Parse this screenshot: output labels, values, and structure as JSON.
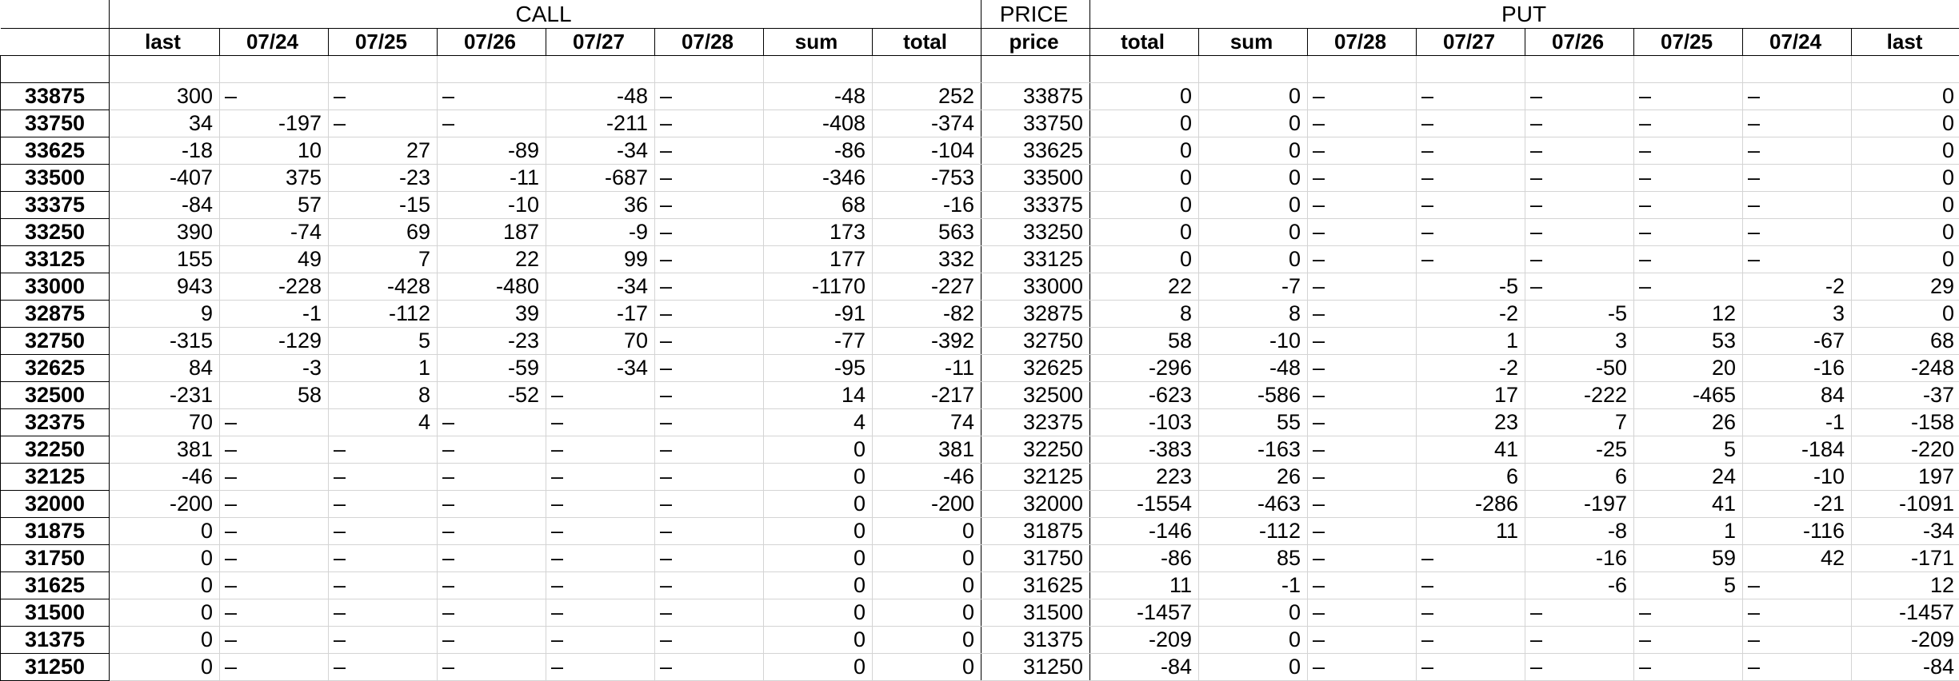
{
  "groups": {
    "call": "CALL",
    "price": "PRICE",
    "put": "PUT"
  },
  "columns": [
    "last",
    "07/24",
    "07/25",
    "07/26",
    "07/27",
    "07/28",
    "sum",
    "total",
    "price",
    "total",
    "sum",
    "07/28",
    "07/27",
    "07/26",
    "07/25",
    "07/24",
    "last"
  ],
  "rows": [
    {
      "label": "33875",
      "cells": [
        "300",
        "–",
        "–",
        "–",
        "-48",
        "–",
        "-48",
        "252",
        "33875",
        "0",
        "0",
        "–",
        "–",
        "–",
        "–",
        "–",
        "0"
      ]
    },
    {
      "label": "33750",
      "cells": [
        "34",
        "-197",
        "–",
        "–",
        "-211",
        "–",
        "-408",
        "-374",
        "33750",
        "0",
        "0",
        "–",
        "–",
        "–",
        "–",
        "–",
        "0"
      ]
    },
    {
      "label": "33625",
      "cells": [
        "-18",
        "10",
        "27",
        "-89",
        "-34",
        "–",
        "-86",
        "-104",
        "33625",
        "0",
        "0",
        "–",
        "–",
        "–",
        "–",
        "–",
        "0"
      ]
    },
    {
      "label": "33500",
      "cells": [
        "-407",
        "375",
        "-23",
        "-11",
        "-687",
        "–",
        "-346",
        "-753",
        "33500",
        "0",
        "0",
        "–",
        "–",
        "–",
        "–",
        "–",
        "0"
      ]
    },
    {
      "label": "33375",
      "cells": [
        "-84",
        "57",
        "-15",
        "-10",
        "36",
        "–",
        "68",
        "-16",
        "33375",
        "0",
        "0",
        "–",
        "–",
        "–",
        "–",
        "–",
        "0"
      ]
    },
    {
      "label": "33250",
      "cells": [
        "390",
        "-74",
        "69",
        "187",
        "-9",
        "–",
        "173",
        "563",
        "33250",
        "0",
        "0",
        "–",
        "–",
        "–",
        "–",
        "–",
        "0"
      ]
    },
    {
      "label": "33125",
      "cells": [
        "155",
        "49",
        "7",
        "22",
        "99",
        "–",
        "177",
        "332",
        "33125",
        "0",
        "0",
        "–",
        "–",
        "–",
        "–",
        "–",
        "0"
      ]
    },
    {
      "label": "33000",
      "cells": [
        "943",
        "-228",
        "-428",
        "-480",
        "-34",
        "–",
        "-1170",
        "-227",
        "33000",
        "22",
        "-7",
        "–",
        "-5",
        "–",
        "–",
        "-2",
        "29"
      ]
    },
    {
      "label": "32875",
      "cells": [
        "9",
        "-1",
        "-112",
        "39",
        "-17",
        "–",
        "-91",
        "-82",
        "32875",
        "8",
        "8",
        "–",
        "-2",
        "-5",
        "12",
        "3",
        "0"
      ]
    },
    {
      "label": "32750",
      "cells": [
        "-315",
        "-129",
        "5",
        "-23",
        "70",
        "–",
        "-77",
        "-392",
        "32750",
        "58",
        "-10",
        "–",
        "1",
        "3",
        "53",
        "-67",
        "68"
      ]
    },
    {
      "label": "32625",
      "cells": [
        "84",
        "-3",
        "1",
        "-59",
        "-34",
        "–",
        "-95",
        "-11",
        "32625",
        "-296",
        "-48",
        "–",
        "-2",
        "-50",
        "20",
        "-16",
        "-248"
      ]
    },
    {
      "label": "32500",
      "cells": [
        "-231",
        "58",
        "8",
        "-52",
        "–",
        "–",
        "14",
        "-217",
        "32500",
        "-623",
        "-586",
        "–",
        "17",
        "-222",
        "-465",
        "84",
        "-37"
      ]
    },
    {
      "label": "32375",
      "cells": [
        "70",
        "–",
        "4",
        "–",
        "–",
        "–",
        "4",
        "74",
        "32375",
        "-103",
        "55",
        "–",
        "23",
        "7",
        "26",
        "-1",
        "-158"
      ]
    },
    {
      "label": "32250",
      "cells": [
        "381",
        "–",
        "–",
        "–",
        "–",
        "–",
        "0",
        "381",
        "32250",
        "-383",
        "-163",
        "–",
        "41",
        "-25",
        "5",
        "-184",
        "-220"
      ]
    },
    {
      "label": "32125",
      "cells": [
        "-46",
        "–",
        "–",
        "–",
        "–",
        "–",
        "0",
        "-46",
        "32125",
        "223",
        "26",
        "–",
        "6",
        "6",
        "24",
        "-10",
        "197"
      ]
    },
    {
      "label": "32000",
      "cells": [
        "-200",
        "–",
        "–",
        "–",
        "–",
        "–",
        "0",
        "-200",
        "32000",
        "-1554",
        "-463",
        "–",
        "-286",
        "-197",
        "41",
        "-21",
        "-1091"
      ]
    },
    {
      "label": "31875",
      "cells": [
        "0",
        "–",
        "–",
        "–",
        "–",
        "–",
        "0",
        "0",
        "31875",
        "-146",
        "-112",
        "–",
        "11",
        "-8",
        "1",
        "-116",
        "-34"
      ]
    },
    {
      "label": "31750",
      "cells": [
        "0",
        "–",
        "–",
        "–",
        "–",
        "–",
        "0",
        "0",
        "31750",
        "-86",
        "85",
        "–",
        "–",
        "-16",
        "59",
        "42",
        "-171"
      ]
    },
    {
      "label": "31625",
      "cells": [
        "0",
        "–",
        "–",
        "–",
        "–",
        "–",
        "0",
        "0",
        "31625",
        "11",
        "-1",
        "–",
        "–",
        "-6",
        "5",
        "–",
        "12"
      ]
    },
    {
      "label": "31500",
      "cells": [
        "0",
        "–",
        "–",
        "–",
        "–",
        "–",
        "0",
        "0",
        "31500",
        "-1457",
        "0",
        "–",
        "–",
        "–",
        "–",
        "–",
        "-1457"
      ]
    },
    {
      "label": "31375",
      "cells": [
        "0",
        "–",
        "–",
        "–",
        "–",
        "–",
        "0",
        "0",
        "31375",
        "-209",
        "0",
        "–",
        "–",
        "–",
        "–",
        "–",
        "-209"
      ]
    },
    {
      "label": "31250",
      "cells": [
        "0",
        "–",
        "–",
        "–",
        "–",
        "–",
        "0",
        "0",
        "31250",
        "-84",
        "0",
        "–",
        "–",
        "–",
        "–",
        "–",
        "-84"
      ]
    }
  ]
}
